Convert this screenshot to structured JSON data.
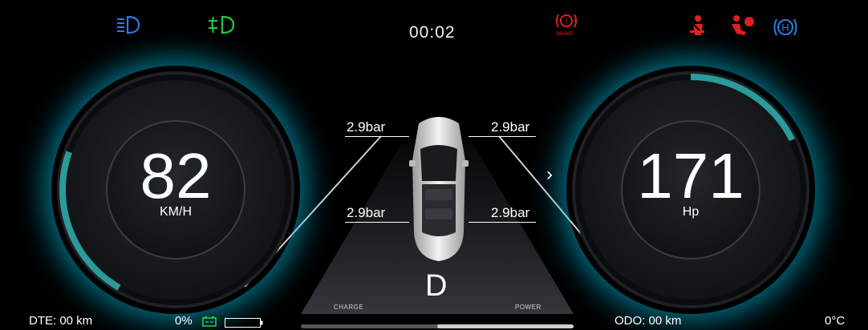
{
  "clock": "00:02",
  "indicators": {
    "left": [
      "low-beam-icon",
      "fog-light-icon"
    ],
    "right": [
      "brake-warning-icon",
      "seatbelt-icon",
      "airbag-icon",
      "parking-brake-icon"
    ],
    "brake_label": "BRAKE",
    "parking_label": "H"
  },
  "speed": {
    "value": "82",
    "unit": "KM/H",
    "fill": 0.2
  },
  "power": {
    "value": "171",
    "unit": "Hp",
    "fill": 0.12
  },
  "tires": {
    "front_left": "2.9bar",
    "front_right": "2.9bar",
    "rear_left": "2.9bar",
    "rear_right": "2.9bar"
  },
  "gear": "D",
  "charge_label": "CHARGE",
  "power_label": "POWER",
  "bottom": {
    "dte": "DTE: 00 km",
    "battery_percent": "0%",
    "odo": "ODO: 00 km",
    "temperature": "0°C"
  },
  "colors": {
    "accent": "#00c8f0",
    "teal": "#2a9a9a",
    "green": "#22cc44",
    "red": "#e02020",
    "blue": "#2a7de1"
  }
}
